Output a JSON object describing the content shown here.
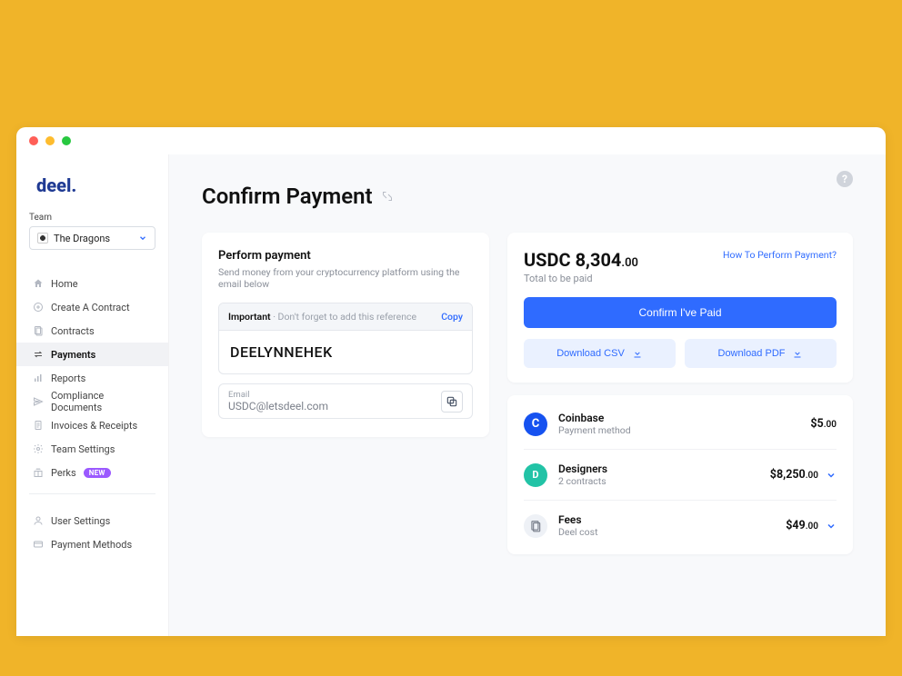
{
  "logo": "deel.",
  "team_label": "Team",
  "team": {
    "name": "The Dragons"
  },
  "nav": {
    "items": [
      {
        "label": "Home"
      },
      {
        "label": "Create A Contract"
      },
      {
        "label": "Contracts"
      },
      {
        "label": "Payments"
      },
      {
        "label": "Reports"
      },
      {
        "label": "Compliance Documents"
      },
      {
        "label": "Invoices & Receipts"
      },
      {
        "label": "Team Settings"
      },
      {
        "label": "Perks",
        "badge": "NEW"
      }
    ],
    "secondary": [
      {
        "label": "User Settings"
      },
      {
        "label": "Payment Methods"
      }
    ]
  },
  "page": {
    "title": "Confirm Payment"
  },
  "perform": {
    "heading": "Perform payment",
    "sub": "Send money from your cryptocurrency platform using the email below",
    "important_label": "Important",
    "important_sep": " · ",
    "important_msg": "Don't forget to add this reference",
    "copy_label": "Copy",
    "reference": "DEELYNNEHEK",
    "email_label": "Email",
    "email_value": "USDC@letsdeel.com"
  },
  "summary": {
    "currency": "USDC",
    "amount_whole": "8,304",
    "amount_cents": ".00",
    "howto": "How To Perform Payment?",
    "total_label": "Total to be paid",
    "confirm_btn": "Confirm I've Paid",
    "download_csv": "Download CSV",
    "download_pdf": "Download PDF"
  },
  "breakdown": [
    {
      "title": "Coinbase",
      "sub": "Payment method",
      "amount": "$5",
      "cents": ".00",
      "expandable": false,
      "avatar": "C",
      "avatar_class": "av-coin"
    },
    {
      "title": "Designers",
      "sub": "2 contracts",
      "amount": "$8,250",
      "cents": ".00",
      "expandable": true,
      "avatar": "D",
      "avatar_class": "av-des"
    },
    {
      "title": "Fees",
      "sub": "Deel cost",
      "amount": "$49",
      "cents": ".00",
      "expandable": true,
      "avatar": "doc",
      "avatar_class": "av-fee"
    }
  ]
}
